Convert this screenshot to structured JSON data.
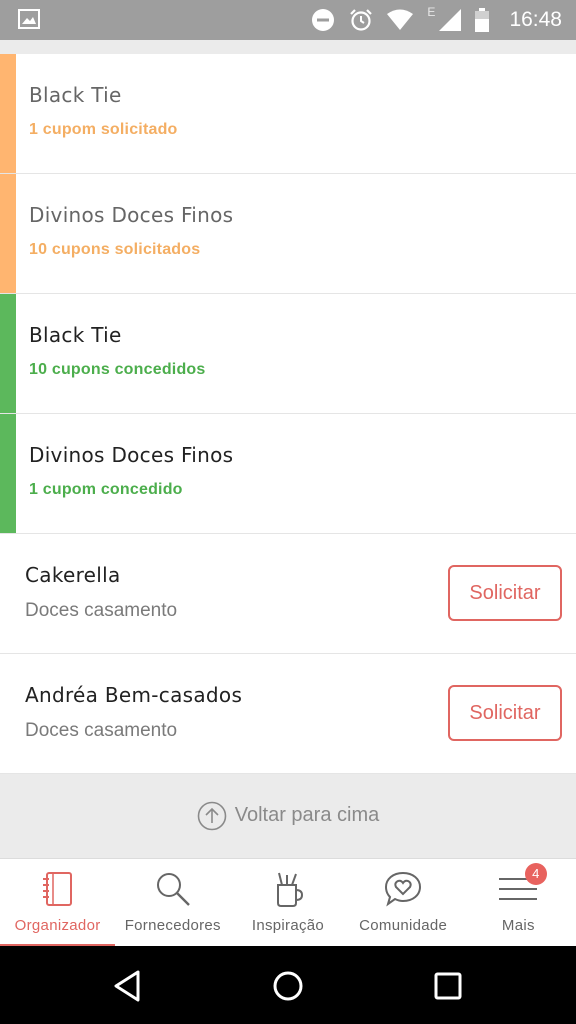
{
  "status_bar": {
    "time": "16:48",
    "network_letter": "E"
  },
  "coupon_rows": [
    {
      "name": "Black Tie",
      "status": "1 cupom solicitado",
      "state": "requested",
      "accent_color": "#ffb570",
      "status_color": "#f4ae63"
    },
    {
      "name": "Divinos Doces Finos",
      "status": "10 cupons solicitados",
      "state": "requested",
      "accent_color": "#ffb570",
      "status_color": "#f4ae63"
    },
    {
      "name": "Black Tie",
      "status": "10 cupons concedidos",
      "state": "granted",
      "accent_color": "#5cb85c",
      "status_color": "#4cae4c"
    },
    {
      "name": "Divinos Doces Finos",
      "status": "1 cupom concedido",
      "state": "granted",
      "accent_color": "#5cb85c",
      "status_color": "#4cae4c"
    }
  ],
  "vendor_rows": [
    {
      "name": "Cakerella",
      "category": "Doces casamento",
      "button_label": "Solicitar"
    },
    {
      "name": "Andréa Bem-casados",
      "category": "Doces casamento",
      "button_label": "Solicitar"
    }
  ],
  "back_to_top": {
    "label": "Voltar para cima"
  },
  "bottom_nav": {
    "items": [
      {
        "label": "Organizador",
        "icon": "notebook-icon",
        "active": true
      },
      {
        "label": "Fornecedores",
        "icon": "search-icon",
        "active": false
      },
      {
        "label": "Inspiração",
        "icon": "brush-cup-icon",
        "active": false
      },
      {
        "label": "Comunidade",
        "icon": "heart-chat-icon",
        "active": false
      },
      {
        "label": "Mais",
        "icon": "menu-icon",
        "active": false,
        "badge": "4"
      }
    ]
  },
  "colors": {
    "accent": "#e06661",
    "requested": "#f4ae63",
    "granted": "#4cae4c"
  }
}
